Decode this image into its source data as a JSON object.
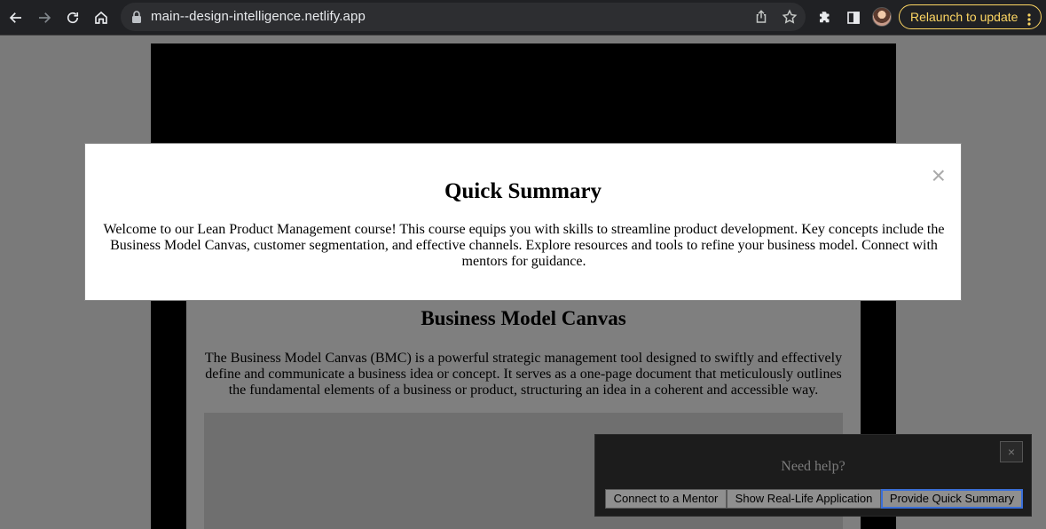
{
  "browser": {
    "url": "main--design-intelligence.netlify.app",
    "relaunch_label": "Relaunch to update",
    "icons": [
      "back-arrow-icon",
      "forward-arrow-icon",
      "reload-icon",
      "home-icon",
      "lock-icon",
      "share-icon",
      "star-icon",
      "extensions-icon",
      "sidepanel-icon",
      "avatar",
      "more-vert-icon"
    ],
    "relaunch_color": "#fdd663"
  },
  "page": {
    "section_title": "Business Model Canvas",
    "section_text": "The Business Model Canvas (BMC) is a powerful strategic management tool designed to swiftly and effectively define and communicate a business idea or concept. It serves as a one-page document that meticulously outlines the fundamental elements of a business or product, structuring an idea in a coherent and accessible way."
  },
  "modal": {
    "close_label": "×",
    "title": "Quick Summary",
    "text": "Welcome to our Lean Product Management course! This course equips you with skills to streamline product development. Key concepts include the Business Model Canvas, customer segmentation, and effective channels. Explore resources and tools to refine your business model. Connect with mentors for guidance."
  },
  "help_widget": {
    "close_label": "×",
    "title": "Need help?",
    "buttons": [
      "Connect to a Mentor",
      "Show Real-Life Application",
      "Provide Quick Summary"
    ],
    "active_button": "Provide Quick Summary",
    "active_color": "#3a6fd8"
  }
}
